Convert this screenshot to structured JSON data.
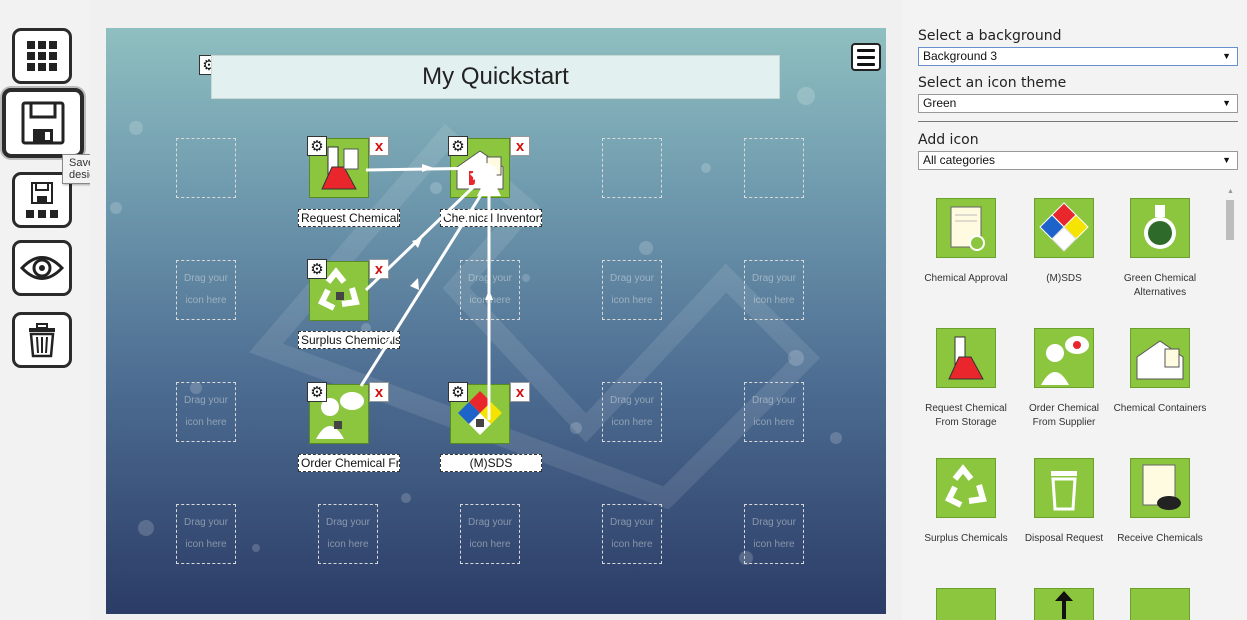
{
  "toolbar": {
    "tools": [
      "grid-layout",
      "save-design",
      "save-as",
      "preview",
      "delete"
    ],
    "tooltip": "Save design"
  },
  "canvas": {
    "title": "My Quickstart",
    "placeholder_line1": "Drag your",
    "placeholder_line2": "icon here",
    "placed_icons": [
      {
        "label": "Request Chemical",
        "icon": "request-chemical-icon"
      },
      {
        "label": "Chemical Inventory",
        "icon": "chemical-inventory-icon"
      },
      {
        "label": "Surplus Chemicals",
        "icon": "surplus-chemicals-icon"
      },
      {
        "label": "Order Chemical From Supplier",
        "icon": "order-chemical-icon"
      },
      {
        "label": "(M)SDS",
        "icon": "msds-icon"
      }
    ],
    "remove_symbol": "x"
  },
  "panel": {
    "background_label": "Select a background",
    "background_value": "Background 3",
    "theme_label": "Select an icon theme",
    "theme_value": "Green",
    "add_icon_label": "Add icon",
    "category_value": "All categories",
    "palette": [
      {
        "label": "Chemical Approval",
        "icon": "chemical-approval-icon"
      },
      {
        "label": "(M)SDS",
        "icon": "msds-icon"
      },
      {
        "label": "Green Chemical Alternatives",
        "icon": "green-chemical-icon"
      },
      {
        "label": "Request Chemical From Storage",
        "icon": "request-chemical-icon"
      },
      {
        "label": "Order Chemical From Supplier",
        "icon": "order-chemical-icon"
      },
      {
        "label": "Chemical Containers",
        "icon": "chemical-containers-icon"
      },
      {
        "label": "Surplus Chemicals",
        "icon": "recycle-icon"
      },
      {
        "label": "Disposal Request",
        "icon": "trash-icon"
      },
      {
        "label": "Receive Chemicals",
        "icon": "receive-chemicals-icon"
      }
    ]
  },
  "colors": {
    "theme_green": "#8cc63f",
    "accent_red": "#d01010"
  }
}
